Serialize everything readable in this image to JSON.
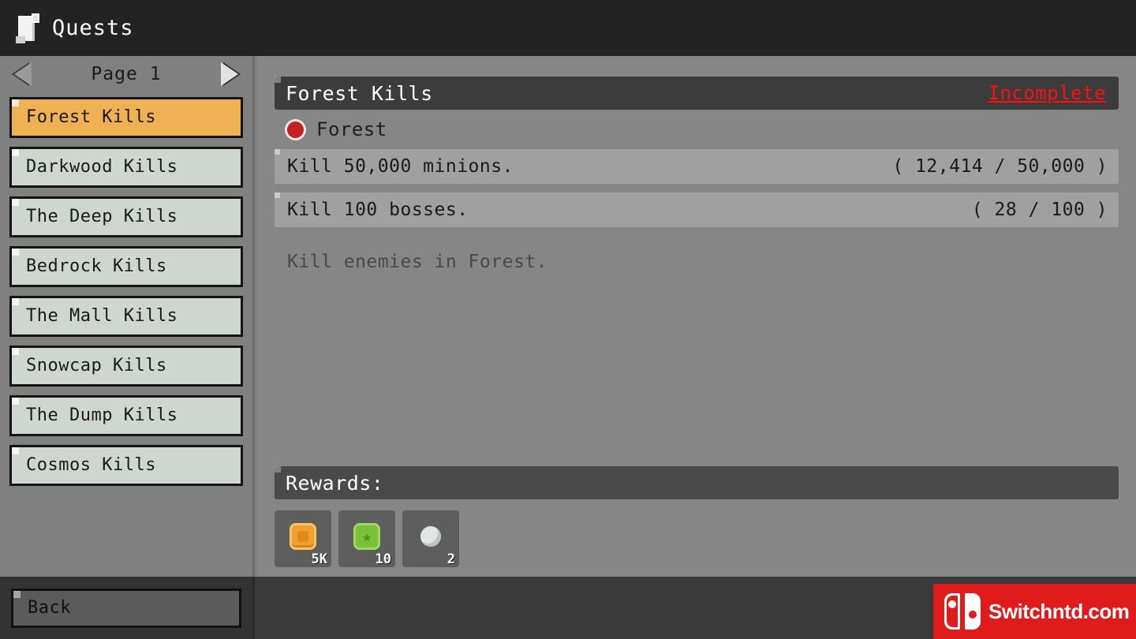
{
  "window": {
    "title": "Quests",
    "icon": "scroll-icon"
  },
  "sidebar": {
    "pager": {
      "label": "Page 1",
      "prev_icon": "triangle-left-icon",
      "next_icon": "triangle-right-icon"
    },
    "items": [
      {
        "label": "Forest Kills",
        "selected": true
      },
      {
        "label": "Darkwood Kills",
        "selected": false
      },
      {
        "label": "The Deep Kills",
        "selected": false
      },
      {
        "label": "Bedrock Kills",
        "selected": false
      },
      {
        "label": "The Mall Kills",
        "selected": false
      },
      {
        "label": "Snowcap Kills",
        "selected": false
      },
      {
        "label": "The Dump Kills",
        "selected": false
      },
      {
        "label": "Cosmos Kills",
        "selected": false
      }
    ]
  },
  "detail": {
    "title": "Forest Kills",
    "status": "Incomplete",
    "status_color": "#ff1010",
    "zone": {
      "label": "Forest",
      "marker_icon": "red-orb-icon",
      "marker_color": "#c42020"
    },
    "objectives": [
      {
        "text": "Kill 50,000 minions.",
        "progress": "( 12,414 / 50,000 )"
      },
      {
        "text": "Kill 100 bosses.",
        "progress": "( 28 / 100 )"
      }
    ],
    "description": "Kill enemies in Forest."
  },
  "rewards": {
    "title": "Rewards:",
    "items": [
      {
        "icon": "gold-coin-icon",
        "count": "5K"
      },
      {
        "icon": "green-token-icon",
        "count": "10"
      },
      {
        "icon": "silver-orb-icon",
        "count": "2"
      }
    ]
  },
  "footer": {
    "back_label": "Back",
    "watermark": {
      "text": "Switchntd.com",
      "icon": "nintendo-switch-icon",
      "color": "#e01b1b"
    }
  }
}
